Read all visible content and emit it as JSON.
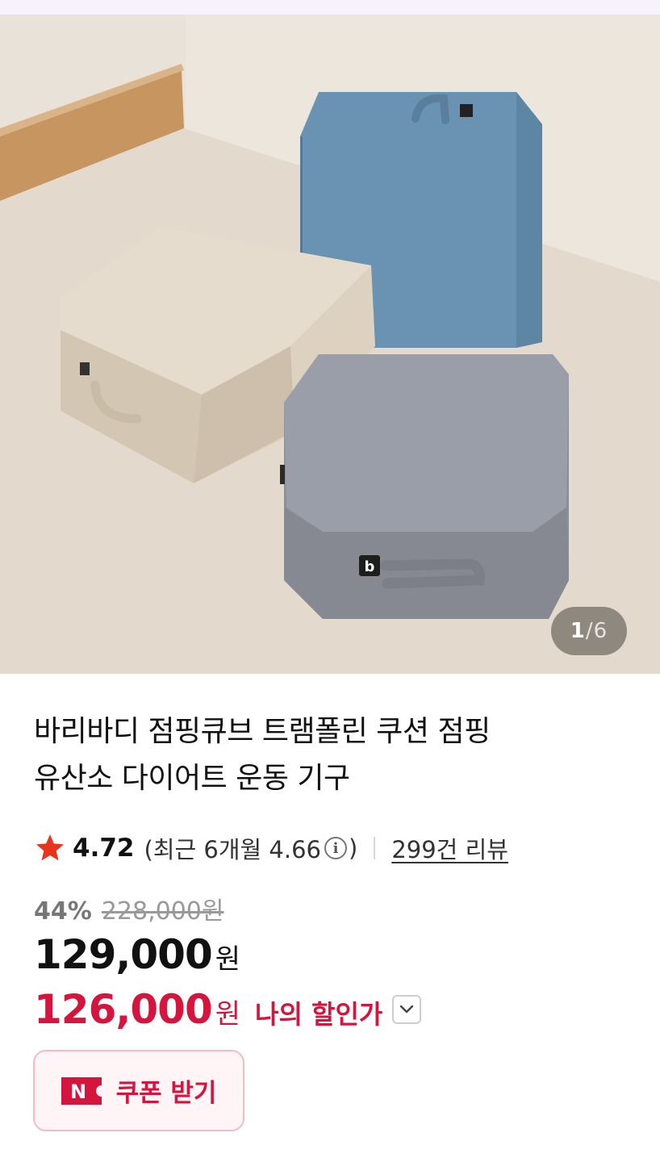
{
  "gallery": {
    "current": "1",
    "separator": "/",
    "total": "6",
    "image_alt": "product-photo-three-cushions"
  },
  "product": {
    "title_line1": "바리바디 점핑큐브 트램폴린 쿠션 점핑",
    "title_line2": "유산소 다이어트 운동 기구"
  },
  "rating": {
    "score": "4.72",
    "recent_open": "(최근 6개월 4.66",
    "recent_close": ")",
    "info_glyph": "i",
    "reviews_label": "299건 리뷰"
  },
  "price": {
    "discount_rate": "44%",
    "original": "228,000원",
    "sale_number": "129,000",
    "sale_unit": "원",
    "my_number": "126,000",
    "my_unit": "원",
    "my_label": "나의 할인가"
  },
  "coupon": {
    "icon_letter": "N",
    "label": "쿠폰 받기"
  },
  "colors": {
    "accent_red": "#d4163f",
    "star": "#e8341c",
    "coupon_bg": "#fff5f7"
  }
}
